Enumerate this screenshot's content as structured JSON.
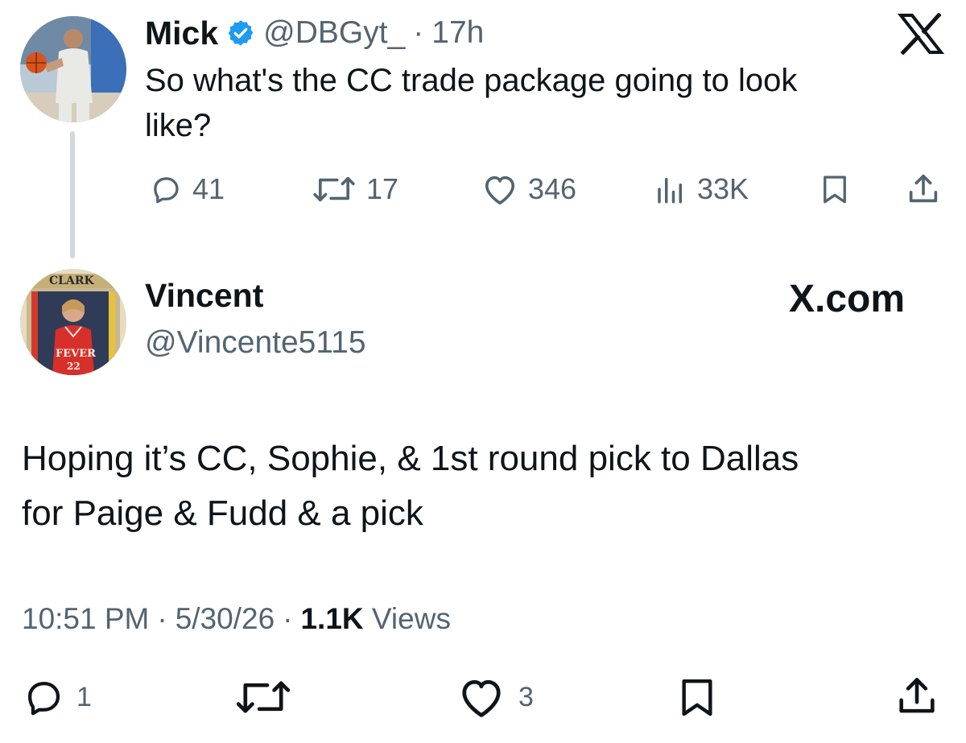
{
  "first_tweet": {
    "name": "Mick",
    "handle": "@DBGyt_",
    "separator": "·",
    "time": "17h",
    "verified": true,
    "text_line1": "So what's the CC trade package going to look",
    "text_line2": "like?",
    "stats": {
      "replies": "41",
      "reposts": "17",
      "likes": "346",
      "views": "33K"
    },
    "icons": [
      "reply-icon",
      "repost-icon",
      "like-icon",
      "views-icon",
      "bookmark-icon",
      "share-icon"
    ]
  },
  "second_tweet": {
    "name": "Vincent",
    "handle": "@Vincente5115",
    "avatar_badge_top": "CLARK",
    "avatar_badge_jersey": "FEVER",
    "avatar_badge_number": "22",
    "text_line1": "Hoping it’s CC, Sophie, & 1st round pick to Dallas",
    "text_line2": "for Paige & Fudd & a pick",
    "time": "10:51 PM",
    "date": "5/30/26",
    "dot": "·",
    "views_count": "1.1K",
    "views_label": "Views",
    "stats": {
      "replies": "1",
      "likes": "3"
    }
  },
  "branding": {
    "x_logo": "X",
    "site_label": "X.com"
  },
  "colors": {
    "verified": "#1d9bf0",
    "muted": "#536471",
    "text": "#0f1419",
    "thread_line": "#cfd9de"
  }
}
